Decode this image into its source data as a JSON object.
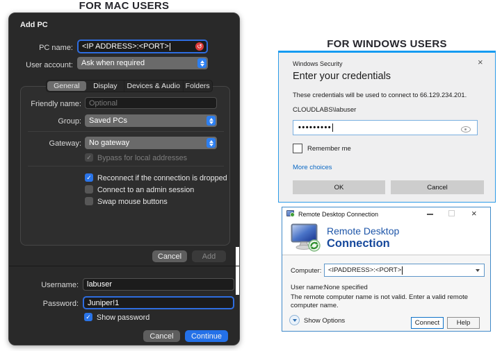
{
  "headings": {
    "mac": "FOR MAC USERS",
    "windows": "FOR WINDOWS USERS"
  },
  "colors": {
    "mac_accent_blue": "#2d7ff0",
    "mac_window_bg": "#292929",
    "continue_blue": "#2471e8",
    "error_red": "#dd3a3a",
    "windows_border_blue": "#149bf2",
    "link_blue": "#0a68c4",
    "rdc_logo_blue": "#17499c"
  },
  "icons": {
    "check": "✓",
    "close": "×",
    "undo": "↺"
  },
  "mac": {
    "title": "Add PC",
    "fields": {
      "pc_name": {
        "label": "PC name:",
        "value": "<IP ADDRESS>:<PORT>"
      },
      "user_account": {
        "label": "User account:",
        "value": "Ask when required"
      },
      "friendly_name": {
        "label": "Friendly name:",
        "placeholder": "Optional"
      },
      "group": {
        "label": "Group:",
        "value": "Saved PCs"
      },
      "gateway": {
        "label": "Gateway:",
        "value": "No gateway"
      }
    },
    "tabs": [
      {
        "label": "General",
        "selected": true
      },
      {
        "label": "Display",
        "selected": false
      },
      {
        "label": "Devices & Audio",
        "selected": false
      },
      {
        "label": "Folders",
        "selected": false
      }
    ],
    "checkboxes": {
      "bypass": {
        "label": "Bypass for local addresses",
        "checked": true,
        "disabled": true
      },
      "reconnect": {
        "label": "Reconnect if the connection is dropped",
        "checked": true,
        "disabled": false
      },
      "admin": {
        "label": "Connect to an admin session",
        "checked": false,
        "disabled": false
      },
      "swap": {
        "label": "Swap mouse buttons",
        "checked": false,
        "disabled": false
      }
    },
    "buttons": {
      "cancel": "Cancel",
      "add": "Add"
    },
    "credentials": {
      "username": {
        "label": "Username:",
        "value": "labuser"
      },
      "password": {
        "label": "Password:",
        "value": "Juniper!1"
      },
      "show_password": "Show password",
      "cancel": "Cancel",
      "continue": "Continue"
    }
  },
  "win_security": {
    "titlebar": "Windows Security",
    "heading": "Enter your credentials",
    "description": "These credentials will be used to connect to 66.129.234.201.",
    "username": "CLOUDLABS\\labuser",
    "password_dots": "•••••••••",
    "remember": "Remember me",
    "more_choices": "More choices",
    "ok": "OK",
    "cancel": "Cancel"
  },
  "rdc": {
    "titlebar": "Remote Desktop Connection",
    "logo_line1": "Remote Desktop",
    "logo_line2": "Connection",
    "computer": {
      "label": "Computer:",
      "value": "<IPADDRESS>:<PORT>"
    },
    "user_name": {
      "label": "User name:",
      "value": "None specified"
    },
    "warning": "The remote computer name is not valid. Enter a valid remote computer name.",
    "show_options": "Show Options",
    "connect": "Connect",
    "help": "Help"
  }
}
